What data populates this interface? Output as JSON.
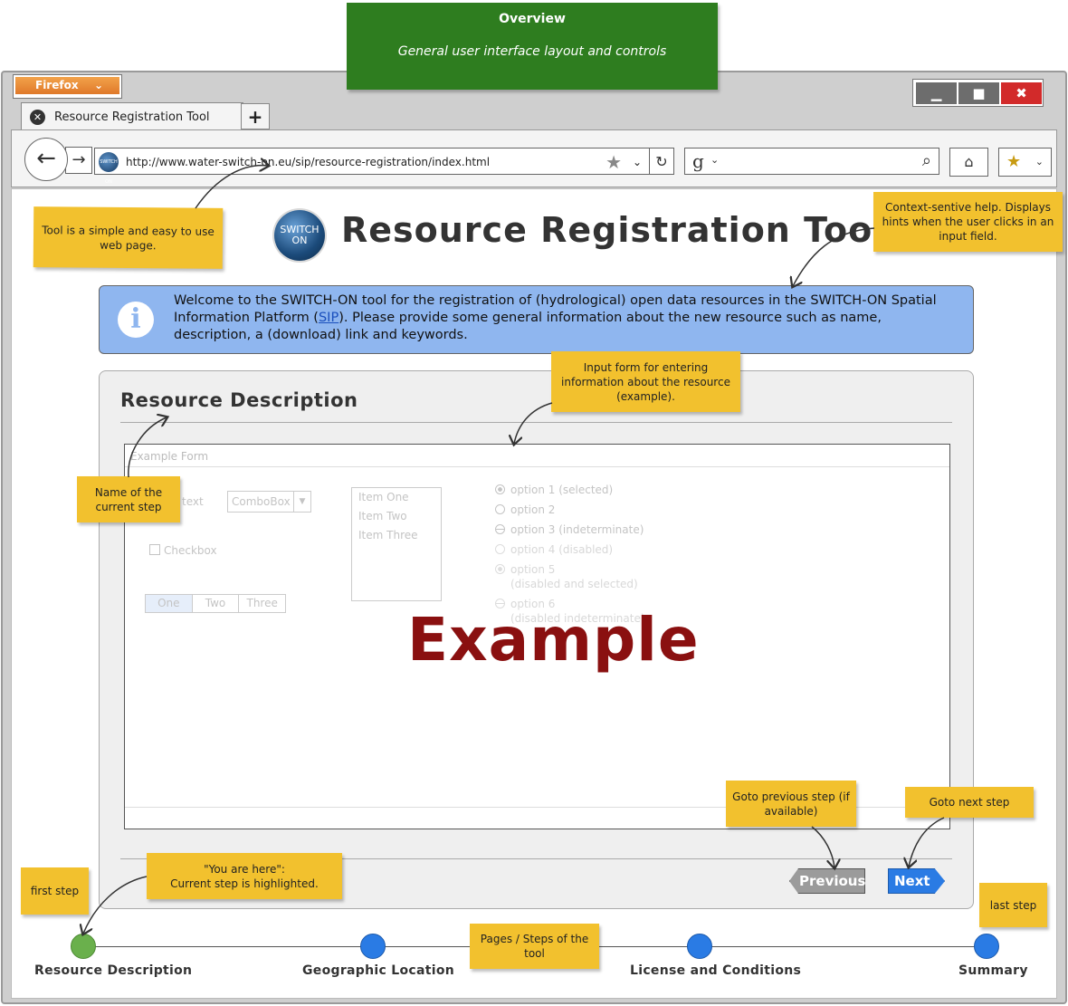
{
  "overview": {
    "title": "Overview",
    "subtitle": "General user interface layout and controls"
  },
  "browser": {
    "menu_label": "Firefox",
    "tab_title": "Resource Registration Tool",
    "new_tab": "+",
    "url": "http://www.water-switch-on.eu/sip/resource-registration/index.html",
    "favicon_text": "SWITCH ON",
    "window_controls": {
      "minimize": "▁",
      "maximize": "■",
      "close": "✖"
    }
  },
  "app": {
    "logo_line1": "SWITCH",
    "logo_line2": "ON",
    "title": "Resource Registration Tool",
    "info_icon": "i",
    "info_pre": "Welcome to the SWITCH-ON tool for the registration of (hydrological) open data resources in the SWITCH-ON Spatial Information Platform (",
    "info_link": "SIP",
    "info_post": "). Please provide some general information about the new resource such as name, description, a (download) link and keywords."
  },
  "step": {
    "title": "Resource Description",
    "form": {
      "header": "Example Form",
      "text_label": "text",
      "combobox": "ComboBox",
      "checkbox": "Checkbox",
      "list_items": [
        "Item One",
        "Item Two",
        "Item Three"
      ],
      "segments": [
        "One",
        "Two",
        "Three"
      ],
      "radios": {
        "r1": "option 1 (selected)",
        "r2": "option 2",
        "r3": "option 3 (indeterminate)",
        "r4": "option 4 (disabled)",
        "r5a": "option 5",
        "r5b": "(disabled and selected)",
        "r6a": "option 6",
        "r6b": "(disabled indeterminate)"
      },
      "watermark": "Example"
    },
    "prev_label": "Previous",
    "next_label": "Next"
  },
  "steps": [
    {
      "label": "Resource Description",
      "color": "#6ab04c"
    },
    {
      "label": "Geographic Location",
      "color": "#2a7be4"
    },
    {
      "label": "License and Conditions",
      "color": "#2a7be4"
    },
    {
      "label": "Summary",
      "color": "#2a7be4"
    }
  ],
  "notes": {
    "simple": "Tool is a simple and easy to use web page.",
    "help": "Context-sentive help. Displays hints when the user clicks in an input field.",
    "form": "Input form for entering information about the resource (example).",
    "name": "Name of the current step",
    "prev": "Goto previous step (if available)",
    "next": "Goto next step",
    "here_1": "\"You are here\":",
    "here_2": "Current step is highlighted.",
    "first": "first step",
    "last": "last step",
    "pages": "Pages / Steps of the tool"
  }
}
